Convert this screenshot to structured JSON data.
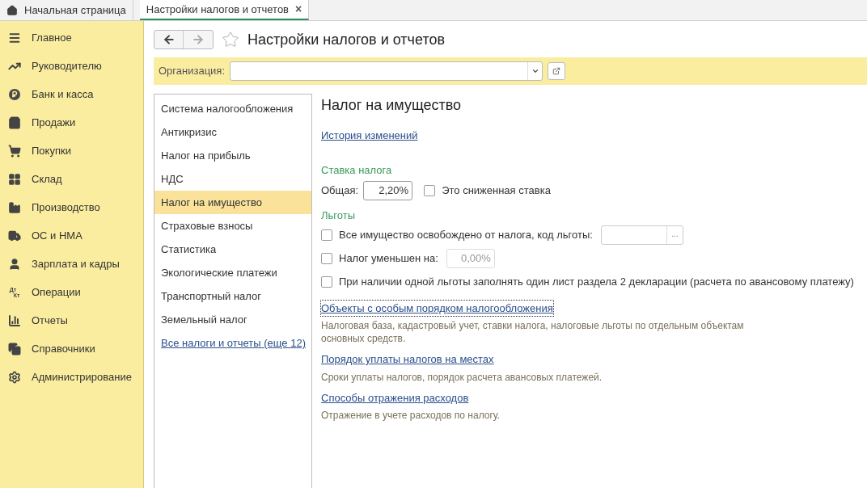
{
  "tabs": [
    {
      "label": "Начальная страница",
      "selected": false,
      "closable": false,
      "home": true
    },
    {
      "label": "Настройки налогов и отчетов",
      "selected": true,
      "closable": true,
      "home": false
    }
  ],
  "close_glyph": "×",
  "sidebar": {
    "items": [
      {
        "label": "Главное"
      },
      {
        "label": "Руководителю"
      },
      {
        "label": "Банк и касса"
      },
      {
        "label": "Продажи"
      },
      {
        "label": "Покупки"
      },
      {
        "label": "Склад"
      },
      {
        "label": "Производство"
      },
      {
        "label": "ОС и НМА"
      },
      {
        "label": "Зарплата и кадры"
      },
      {
        "label": "Операции",
        "icon_text": [
          "Дт",
          "Кт"
        ]
      },
      {
        "label": "Отчеты"
      },
      {
        "label": "Справочники"
      },
      {
        "label": "Администрирование"
      }
    ]
  },
  "page": {
    "title": "Настройки налогов и отчетов",
    "favorite": false
  },
  "organization": {
    "label": "Организация:"
  },
  "sections": {
    "items": [
      {
        "label": "Система налогообложения",
        "selected": false
      },
      {
        "label": "Антикризис",
        "selected": false
      },
      {
        "label": "Налог на прибыль",
        "selected": false
      },
      {
        "label": "НДС",
        "selected": false
      },
      {
        "label": "Налог на имущество",
        "selected": true
      },
      {
        "label": "Страховые взносы",
        "selected": false
      },
      {
        "label": "Статистика",
        "selected": false
      },
      {
        "label": "Экологические платежи",
        "selected": false
      },
      {
        "label": "Транспортный налог",
        "selected": false
      },
      {
        "label": "Земельный налог",
        "selected": false
      }
    ],
    "more_link": "Все налоги и отчеты (еще 12)"
  },
  "detail": {
    "title": "Налог на имущество",
    "history_link": "История изменений",
    "rate_group": "Ставка налога",
    "rate_label": "Общая:",
    "rate_value": "2,20%",
    "reduced_rate": {
      "label": "Это сниженная ставка",
      "checked": false
    },
    "benefits_group": "Льготы",
    "benefits": [
      {
        "kind": "picker",
        "label": "Все имущество освобождено от налога, код льготы:",
        "checked": false,
        "button": "..."
      },
      {
        "kind": "number",
        "label": "Налог уменьшен на:",
        "checked": false,
        "value": "0,00%"
      },
      {
        "kind": "plain",
        "label": "При наличии одной льготы заполнять один лист раздела 2 декларации (расчета по авансовому платежу)",
        "checked": false
      }
    ],
    "links": [
      {
        "label": "Объекты с особым порядком налогообложения",
        "focused": true,
        "description": "Налоговая база, кадастровый учет, ставки налога, налоговые льготы по отдельным объектам основных средств."
      },
      {
        "label": "Порядок уплаты налогов на местах",
        "focused": false,
        "description": "Сроки уплаты налогов, порядок расчета авансовых платежей."
      },
      {
        "label": "Способы отражения расходов",
        "focused": false,
        "description": "Отражение в учете расходов по налогу."
      }
    ]
  }
}
